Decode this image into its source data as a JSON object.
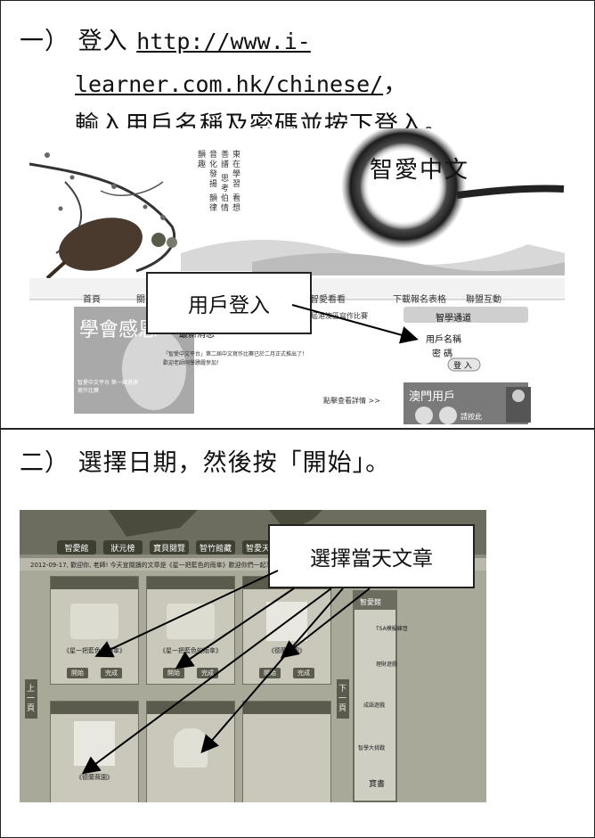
{
  "step1": {
    "marker": "一）",
    "verb": "登入",
    "url_part1": "http://www.i-",
    "url_part2": "learner.com.hk/chinese/",
    "trailing": "，",
    "instruction": "輸入用戶名稱及密碼並按下登入。"
  },
  "step2": {
    "marker": "二）",
    "instruction": "選擇日期，然後按「開始」。"
  },
  "shot1": {
    "logo": "智愛中文",
    "nav": [
      "首頁",
      "關",
      "智愛看看",
      "下載報名表格",
      "聯盟互動"
    ],
    "callout": "用戶登入",
    "panel_title": "智學通道",
    "username_label": "用戶名稱",
    "password_label": "密 碼",
    "login_button": "登 入",
    "news_title": "最新消息",
    "news_line1": "「智愛中文平台」第二屆中文寫作比賽已於二月正式推出了！",
    "news_line2": "歡迎老師同學踴躍參加！",
    "competition": "第二屆港澳區寫作比賽",
    "more_link": "點擊查看詳情 >>",
    "banner_text": "學會感恩",
    "banner_sub": "智愛中文平台 第一屆港澳寫作比賽",
    "ad_text": "澳門用戶",
    "ad_sub": "請按此"
  },
  "shot2": {
    "callout": "選擇當天文章",
    "tabs": [
      "智愛館",
      "狀元榜",
      "寶貝閱覽",
      "智竹館藏",
      "智愛天地"
    ],
    "date_line": "2012-09-17, 歡迎你, 老師! 今天宣閱讀的文章是《星一把藍色的雨傘》歡迎你們一起享受閱讀吧",
    "prev_page": "上一頁",
    "next_page": "下一頁",
    "card_captions": [
      "《星一把藍色的雨傘》",
      "《星一把藍色的雨傘》",
      "《德蘭茸園》",
      "《德蘭茸園》",
      "",
      ""
    ],
    "btn_read": "開始",
    "btn_done": "完成",
    "side_title": "智愛館",
    "side_items": [
      "TSA模擬練習",
      "理財遊戲",
      "成語遊戲",
      "智學大挑戰",
      "寶書"
    ]
  }
}
